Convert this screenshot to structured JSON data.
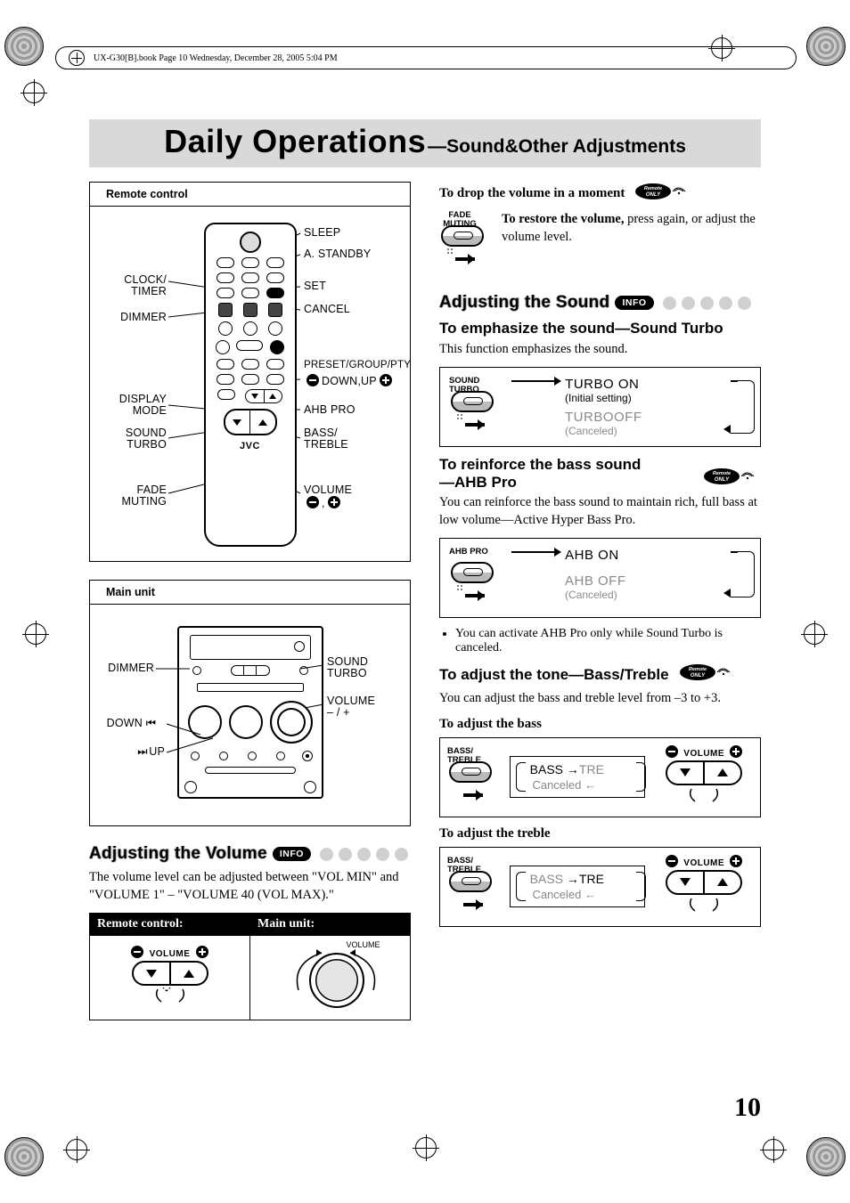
{
  "doc_trace": "UX-G30[B].book  Page 10  Wednesday, December 28, 2005  5:04 PM",
  "title_main": "Daily Operations",
  "title_sub": "—Sound&Other Adjustments",
  "panels": {
    "remote": {
      "heading": "Remote control",
      "logo": "JVC",
      "left": {
        "clock_timer_1": "CLOCK/",
        "clock_timer_2": "TIMER",
        "dimmer": "DIMMER",
        "display_1": "DISPLAY",
        "display_2": "MODE",
        "sound_1": "SOUND",
        "sound_2": "TURBO",
        "fade_1": "FADE",
        "fade_2": "MUTING"
      },
      "right": {
        "sleep": "SLEEP",
        "astandby": "A. STANDBY",
        "set": "SET",
        "cancel": "CANCEL",
        "preset": "PRESET/GROUP/PTY",
        "downup_pre": "DOWN,UP",
        "ahb": "AHB PRO",
        "bass_1": "BASS/",
        "bass_2": "TREBLE",
        "vol_1": "VOLUME",
        "vol_2_pre": ","
      }
    },
    "main": {
      "heading": "Main unit",
      "left": {
        "dimmer": "DIMMER",
        "down": "DOWN",
        "up": "UP"
      },
      "right": {
        "sound_1": "SOUND",
        "sound_2": "TURBO",
        "vol_1": "VOLUME",
        "vol_2": "– / +"
      }
    }
  },
  "left_section": {
    "heading": "Adjusting the Volume",
    "pill": "INFO",
    "body": "The volume level can be adjusted between \"VOL MIN\" and \"VOLUME 1\" – \"VOLUME 40 (VOL MAX).\"",
    "table": {
      "h1": "Remote control:",
      "h2": "Main unit:",
      "vol_label": "VOLUME",
      "knob_label": "VOLUME"
    }
  },
  "right": {
    "drop": {
      "heading": "To drop the volume in a moment",
      "btn_label": "FADE\nMUTING",
      "restore_b": "To restore the volume,",
      "restore_rest": " press again, or adjust the volume level."
    },
    "sound_hd": "Adjusting the Sound",
    "pill": "INFO",
    "emph": {
      "heading": "To emphasize the sound—Sound Turbo",
      "body": "This function emphasizes the sound.",
      "btn_label": "SOUND\nTURBO",
      "state1": "TURBO ON",
      "state1_sub": "(Initial setting)",
      "state2": "TURBOOFF",
      "state2_sub": "(Canceled)"
    },
    "ahb": {
      "heading_l1": "To reinforce the bass sound",
      "heading_l2": "—AHB Pro",
      "body": "You can reinforce the bass sound to maintain rich, full bass at low volume—Active Hyper Bass Pro.",
      "btn_label": "AHB PRO",
      "state1": "AHB ON",
      "state2": "AHB OFF",
      "state2_sub": "(Canceled)",
      "note": "You can activate AHB Pro only while Sound Turbo is canceled."
    },
    "tone": {
      "heading": "To adjust the tone—Bass/Treble",
      "body": "You can adjust the bass and treble level from –3 to +3.",
      "sub_bass": "To adjust the bass",
      "sub_treble": "To adjust the treble",
      "btn_label": "BASS/\nTREBLE",
      "bass_word": "BASS",
      "tre_word": "TRE",
      "canceled": "Canceled",
      "vol_label": "VOLUME"
    },
    "remote_only": "Remote ONLY"
  },
  "page_number": "10"
}
